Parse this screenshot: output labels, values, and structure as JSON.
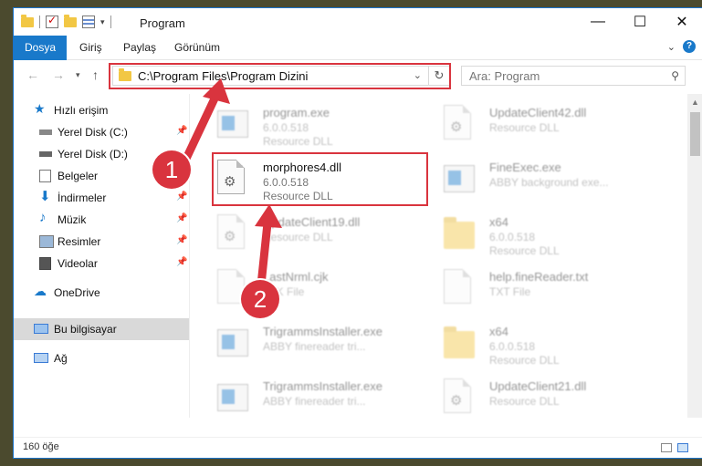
{
  "window": {
    "title": "Program",
    "buttons": {
      "minimize": "—",
      "maximize": "☐",
      "close": "✕"
    }
  },
  "ribbon": {
    "tabs": [
      "Dosya",
      "Giriş",
      "Paylaş",
      "Görünüm"
    ],
    "help": "?"
  },
  "address": {
    "path": "C:\\Program Files\\Program Dizini",
    "search_placeholder": "Ara: Program"
  },
  "sidebar": {
    "quick_access": "Hızlı erişim",
    "items": [
      {
        "label": "Yerel Disk (C:)",
        "icon": "drive-icon"
      },
      {
        "label": "Yerel Disk (D:)",
        "icon": "drive-icon"
      },
      {
        "label": "Belgeler",
        "icon": "documents-icon"
      },
      {
        "label": "İndirmeler",
        "icon": "downloads-icon"
      },
      {
        "label": "Müzik",
        "icon": "music-icon"
      },
      {
        "label": "Resimler",
        "icon": "pictures-icon"
      },
      {
        "label": "Videolar",
        "icon": "videos-icon"
      }
    ],
    "onedrive": "OneDrive",
    "this_pc": "Bu bilgisayar",
    "network": "Ağ"
  },
  "files": {
    "left": [
      {
        "name": "program.exe",
        "line1": "6.0.0.518",
        "line2": "Resource DLL"
      },
      {
        "name": "morphores4.dll",
        "line1": "6.0.0.518",
        "line2": "Resource DLL"
      },
      {
        "name": "UpdateClient19.dll",
        "line1": "Resource DLL",
        "line2": ""
      },
      {
        "name": "LastNrml.cjk",
        "line1": "CJK File",
        "line2": ""
      },
      {
        "name": "TrigrammsInstaller.exe",
        "line1": "ABBY finereader tri...",
        "line2": ""
      },
      {
        "name": "TrigrammsInstaller.exe",
        "line1": "ABBY finereader tri...",
        "line2": ""
      }
    ],
    "right": [
      {
        "name": "UpdateClient42.dll",
        "line1": "Resource DLL",
        "line2": ""
      },
      {
        "name": "FineExec.exe",
        "line1": "ABBY background exe...",
        "line2": ""
      },
      {
        "name": "x64",
        "line1": "6.0.0.518",
        "line2": "Resource DLL"
      },
      {
        "name": "help.fineReader.txt",
        "line1": "TXT File",
        "line2": ""
      },
      {
        "name": "x64",
        "line1": "6.0.0.518",
        "line2": "Resource DLL"
      },
      {
        "name": "UpdateClient21.dll",
        "line1": "Resource DLL",
        "line2": ""
      }
    ]
  },
  "status": {
    "item_count": "160 öğe"
  },
  "annotations": {
    "step1": "1",
    "step2": "2"
  },
  "colors": {
    "accent": "#1979ca",
    "highlight": "#d9343e",
    "folder": "#f2c744"
  }
}
